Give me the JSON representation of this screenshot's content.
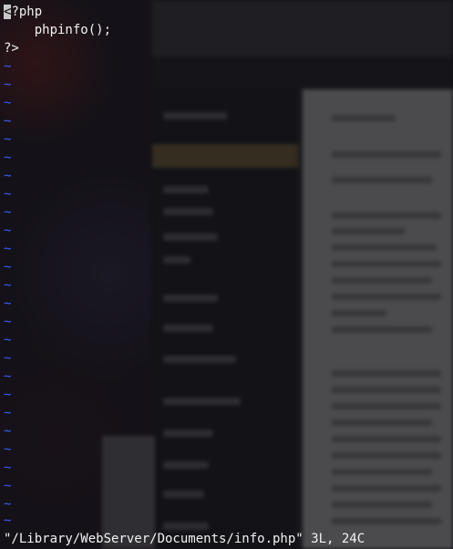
{
  "editor": {
    "code_lines": [
      {
        "cursor": "<",
        "rest": "?php"
      },
      {
        "cursor": "",
        "rest": "    phpinfo();"
      },
      {
        "cursor": "",
        "rest": "?>"
      }
    ],
    "empty_line_marker": "~",
    "empty_line_count": 27,
    "status_message": "\"/Library/WebServer/Documents/info.php\" 3L, 24C"
  },
  "colors": {
    "text": "#f2f2f2",
    "tilde": "#3d5cff",
    "cursor": "#c8c8c8"
  }
}
